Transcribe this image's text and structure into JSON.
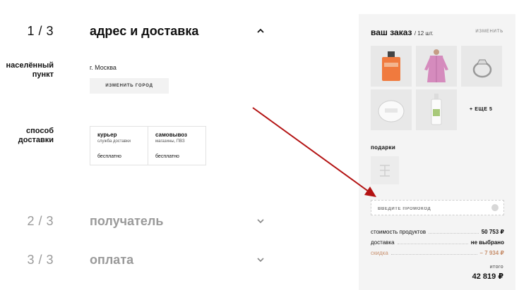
{
  "steps": [
    {
      "number": "1 / 3",
      "title": "адрес и доставка"
    },
    {
      "number": "2 / 3",
      "title": "получатель"
    },
    {
      "number": "3 / 3",
      "title": "оплата"
    }
  ],
  "address": {
    "city_label": "населённый пункт",
    "city_value": "г. Москва",
    "change_city_button": "ИЗМЕНИТЬ ГОРОД",
    "delivery_label": "способ доставки",
    "options": [
      {
        "title": "курьер",
        "subtitle": "служба доставки",
        "price": "бесплатно"
      },
      {
        "title": "самовывоз",
        "subtitle": "магазины, ПВЗ",
        "price": "бесплатно"
      }
    ]
  },
  "order": {
    "title": "ваш заказ",
    "count": "/ 12 шт.",
    "change_link": "ИЗМЕНИТЬ",
    "more_label": "+ ЕЩЕ 5",
    "products": [
      "perfume-bottle",
      "pink-robe",
      "diamond-ring",
      "face-cream-jar",
      "serum-bottle"
    ],
    "gifts_label": "подарки",
    "promo_placeholder": "ВВЕДИТЕ ПРОМОКОД",
    "summary": [
      {
        "label": "стоимость продуктов",
        "value": "50 753 ₽"
      },
      {
        "label": "доставка",
        "value": "не выбрано"
      },
      {
        "label": "скидка",
        "value": "– 7 934 ₽"
      }
    ],
    "total_label": "итого",
    "total_value": "42 819 ₽"
  },
  "colors": {
    "accent_discount": "#c8916f",
    "arrow": "#b31212",
    "panel_bg": "#f4f4f4"
  }
}
